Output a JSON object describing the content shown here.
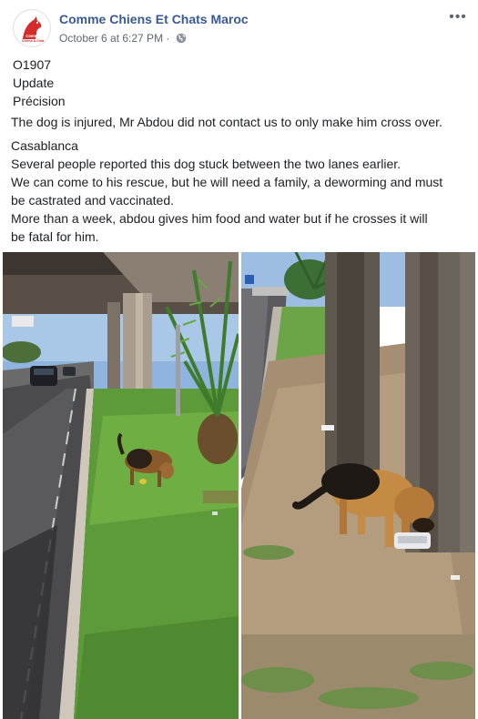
{
  "post": {
    "page_name": "Comme Chiens Et Chats Maroc",
    "timestamp": "October 6 at 6:27 PM",
    "separator": "·",
    "avatar_text": [
      "Comme",
      "Chiens & Chat"
    ],
    "more_label": "•••",
    "block1": [
      "O1907",
      "Update",
      "Précision"
    ],
    "block2": [
      "The dog is injured, Mr Abdou did not contact us to only make him cross over."
    ],
    "block3": [
      "Casablanca",
      "Several people reported this dog stuck between the two lanes earlier.",
      "We can come to his rescue, but he will need a family, a deworming and must",
      "be castrated and vaccinated.",
      "More than a week, abdou gives him food and water but if he crosses it will",
      "be fatal for him."
    ]
  },
  "photos": [
    {
      "icon": "dog-photo-roadside"
    },
    {
      "icon": "dog-photo-under-bridge"
    }
  ],
  "colors": {
    "link": "#385898",
    "meta": "#616770",
    "text": "#1c1e21",
    "brand_red": "#d62b2b"
  }
}
